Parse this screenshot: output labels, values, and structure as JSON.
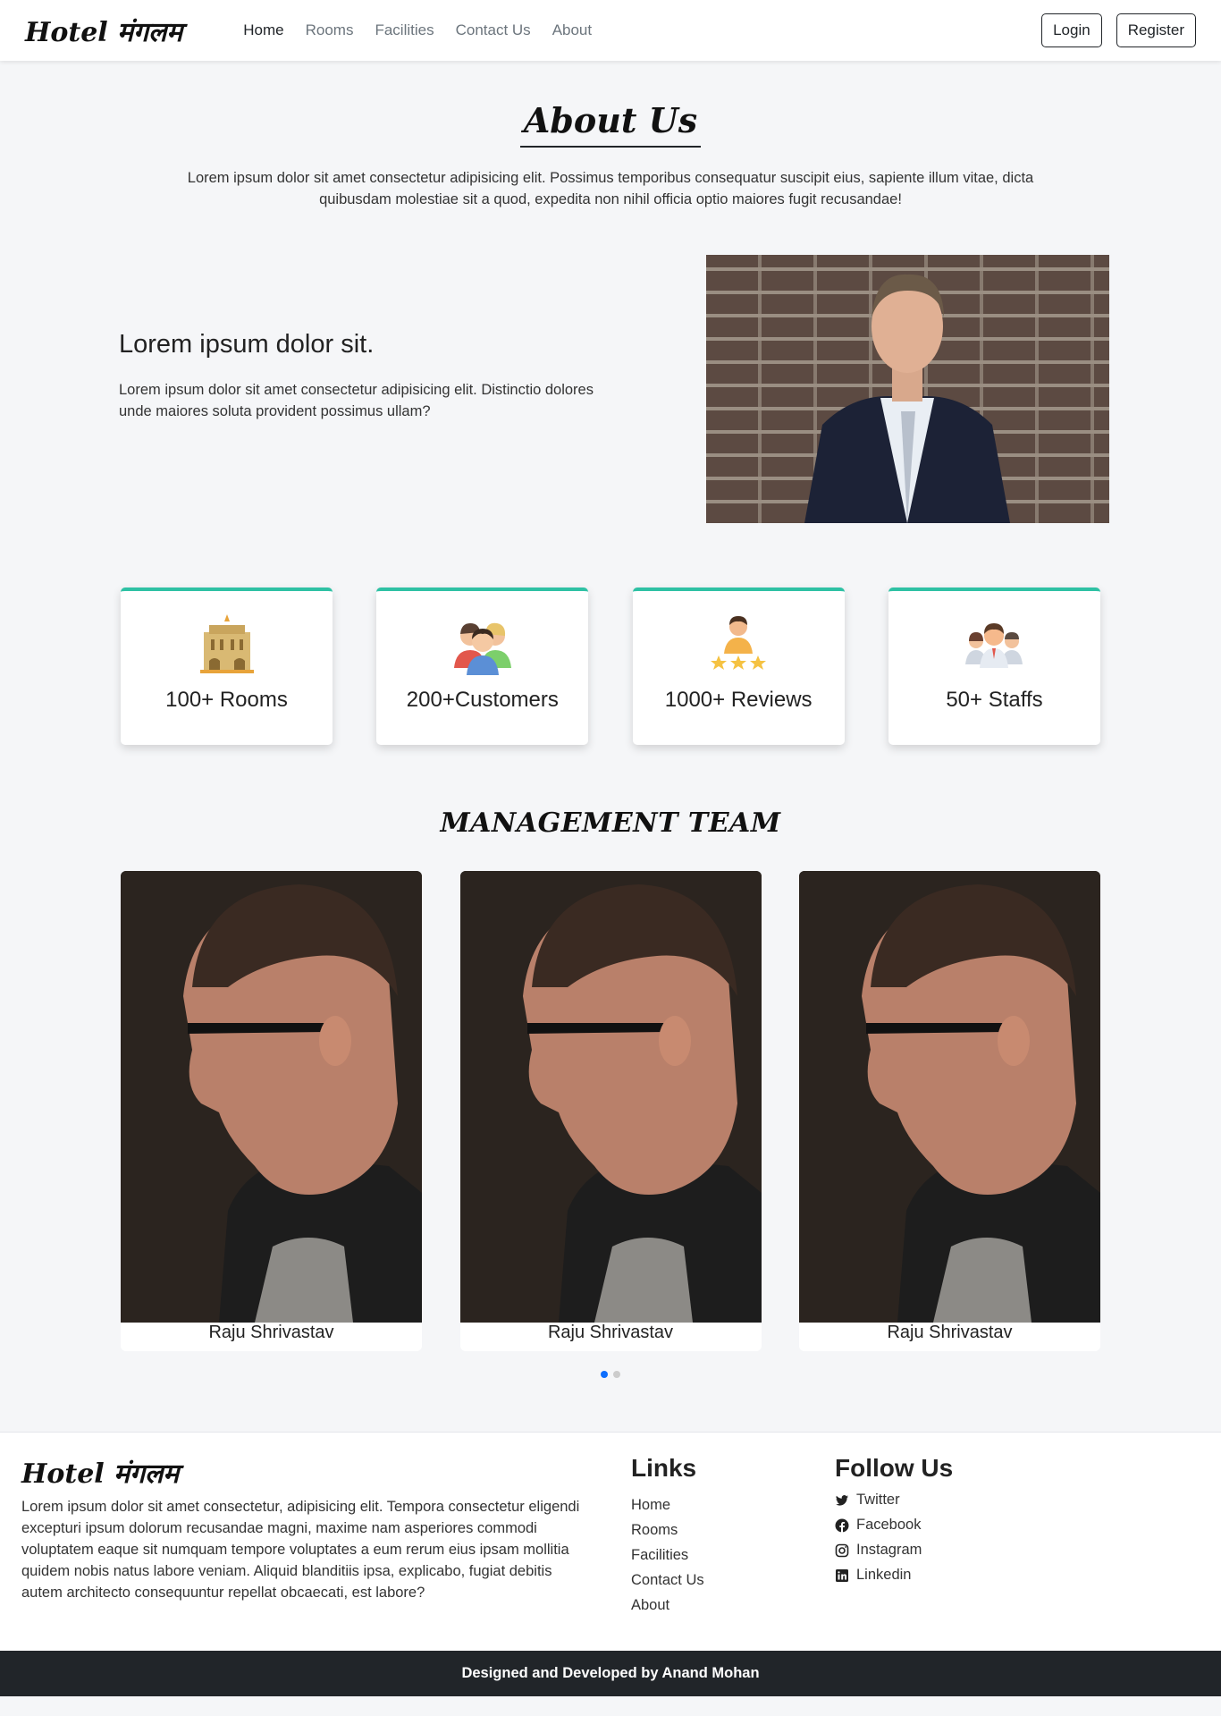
{
  "navbar": {
    "brand": "Hotel मंगलम",
    "links": [
      "Home",
      "Rooms",
      "Facilities",
      "Contact Us",
      "About"
    ],
    "login": "Login",
    "register": "Register"
  },
  "about": {
    "title": "About Us",
    "description": "Lorem ipsum dolor sit amet consectetur adipisicing elit. Possimus temporibus consequatur suscipit eius, sapiente illum vitae, dicta quibusdam molestiae sit a quod, expedita non nihil officia optio maiores fugit recusandae!"
  },
  "intro": {
    "heading": "Lorem ipsum dolor sit.",
    "text": "Lorem ipsum dolor sit amet consectetur adipisicing elit. Distinctio dolores unde maiores soluta provident possimus ullam?"
  },
  "stats": [
    {
      "label": "100+ Rooms",
      "icon": "hotel-icon"
    },
    {
      "label": "200+Customers",
      "icon": "customers-icon"
    },
    {
      "label": "1000+ Reviews",
      "icon": "reviews-icon"
    },
    {
      "label": "50+ Staffs",
      "icon": "staff-icon"
    }
  ],
  "team": {
    "title": "MANAGEMENT TEAM",
    "members": [
      {
        "name": "Raju Shrivastav"
      },
      {
        "name": "Raju Shrivastav"
      },
      {
        "name": "Raju Shrivastav"
      }
    ]
  },
  "footer": {
    "brand": "Hotel मंगलम",
    "description": "Lorem ipsum dolor sit amet consectetur, adipisicing elit. Tempora consectetur eligendi excepturi ipsum dolorum recusandae magni, maxime nam asperiores commodi voluptatem eaque sit numquam tempore voluptates a eum rerum eius ipsam mollitia quidem nobis natus labore veniam. Aliquid blanditiis ipsa, explicabo, fugiat debitis autem architecto consequuntur repellat obcaecati, est labore?",
    "links_heading": "Links",
    "links": [
      "Home",
      "Rooms",
      "Facilities",
      "Contact Us",
      "About"
    ],
    "follow_heading": "Follow Us",
    "social": [
      "Twitter",
      "Facebook",
      "Instagram",
      "Linkedin"
    ]
  },
  "credits": "Designed and Developed by Anand Mohan",
  "colors": {
    "accent": "#2ec1a4",
    "dark": "#212529",
    "active_dot": "#0d6efd"
  }
}
